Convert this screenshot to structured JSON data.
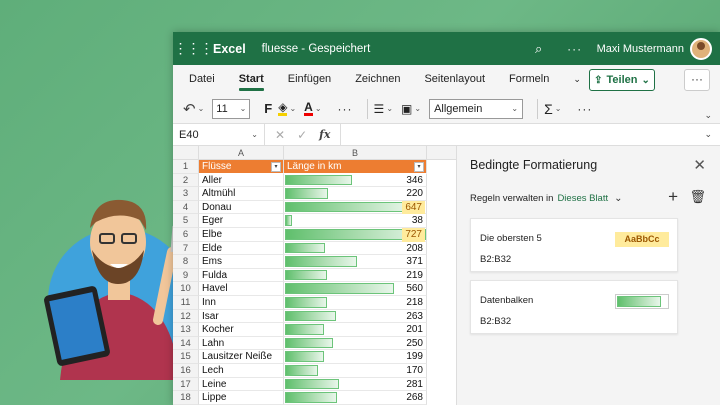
{
  "title_bar": {
    "app_name": "Excel",
    "document": "fluesse - Gespeichert",
    "user": "Maxi Mustermann",
    "more": "···"
  },
  "menu": {
    "items": [
      "Datei",
      "Start",
      "Einfügen",
      "Zeichnen",
      "Seitenlayout",
      "Formeln"
    ],
    "active": "Start",
    "share_label": "Teilen",
    "more_label": "···"
  },
  "ribbon": {
    "font_size": "11",
    "bold_label": "F",
    "number_format": "Allgemein",
    "dots": "···"
  },
  "formula_bar": {
    "name_box": "E40",
    "fx_label": "fx"
  },
  "sheet": {
    "columns": [
      "A",
      "B"
    ],
    "header_row": {
      "number": "1",
      "a": "Flüsse",
      "b": "Länge in km"
    },
    "max_value": 727,
    "rows": [
      {
        "n": "2",
        "river": "Aller",
        "length": 346,
        "top": false
      },
      {
        "n": "3",
        "river": "Altmühl",
        "length": 220,
        "top": false
      },
      {
        "n": "4",
        "river": "Donau",
        "length": 647,
        "top": true
      },
      {
        "n": "5",
        "river": "Eger",
        "length": 38,
        "top": false
      },
      {
        "n": "6",
        "river": "Elbe",
        "length": 727,
        "top": true
      },
      {
        "n": "7",
        "river": "Elde",
        "length": 208,
        "top": false
      },
      {
        "n": "8",
        "river": "Ems",
        "length": 371,
        "top": false
      },
      {
        "n": "9",
        "river": "Fulda",
        "length": 219,
        "top": false
      },
      {
        "n": "10",
        "river": "Havel",
        "length": 560,
        "top": false
      },
      {
        "n": "11",
        "river": "Inn",
        "length": 218,
        "top": false
      },
      {
        "n": "12",
        "river": "Isar",
        "length": 263,
        "top": false
      },
      {
        "n": "13",
        "river": "Kocher",
        "length": 201,
        "top": false
      },
      {
        "n": "14",
        "river": "Lahn",
        "length": 250,
        "top": false
      },
      {
        "n": "15",
        "river": "Lausitzer Neiße",
        "length": 199,
        "top": false
      },
      {
        "n": "16",
        "river": "Lech",
        "length": 170,
        "top": false
      },
      {
        "n": "17",
        "river": "Leine",
        "length": 281,
        "top": false
      },
      {
        "n": "18",
        "river": "Lippe",
        "length": 268,
        "top": false
      }
    ]
  },
  "pane": {
    "title": "Bedingte Formatierung",
    "rules_label": "Regeln verwalten in",
    "scope": "Dieses Blatt",
    "rules": [
      {
        "name": "Die obersten 5",
        "range": "B2:B32",
        "preview": "AaBbCc"
      },
      {
        "name": "Datenbalken",
        "range": "B2:B32",
        "preview": ""
      }
    ]
  },
  "colors": {
    "excel_green": "#1f7145",
    "header_orange": "#ed7d31",
    "top_fill": "#ffeb9c",
    "top_text": "#9c5700",
    "databar": "#5fbf6c"
  }
}
